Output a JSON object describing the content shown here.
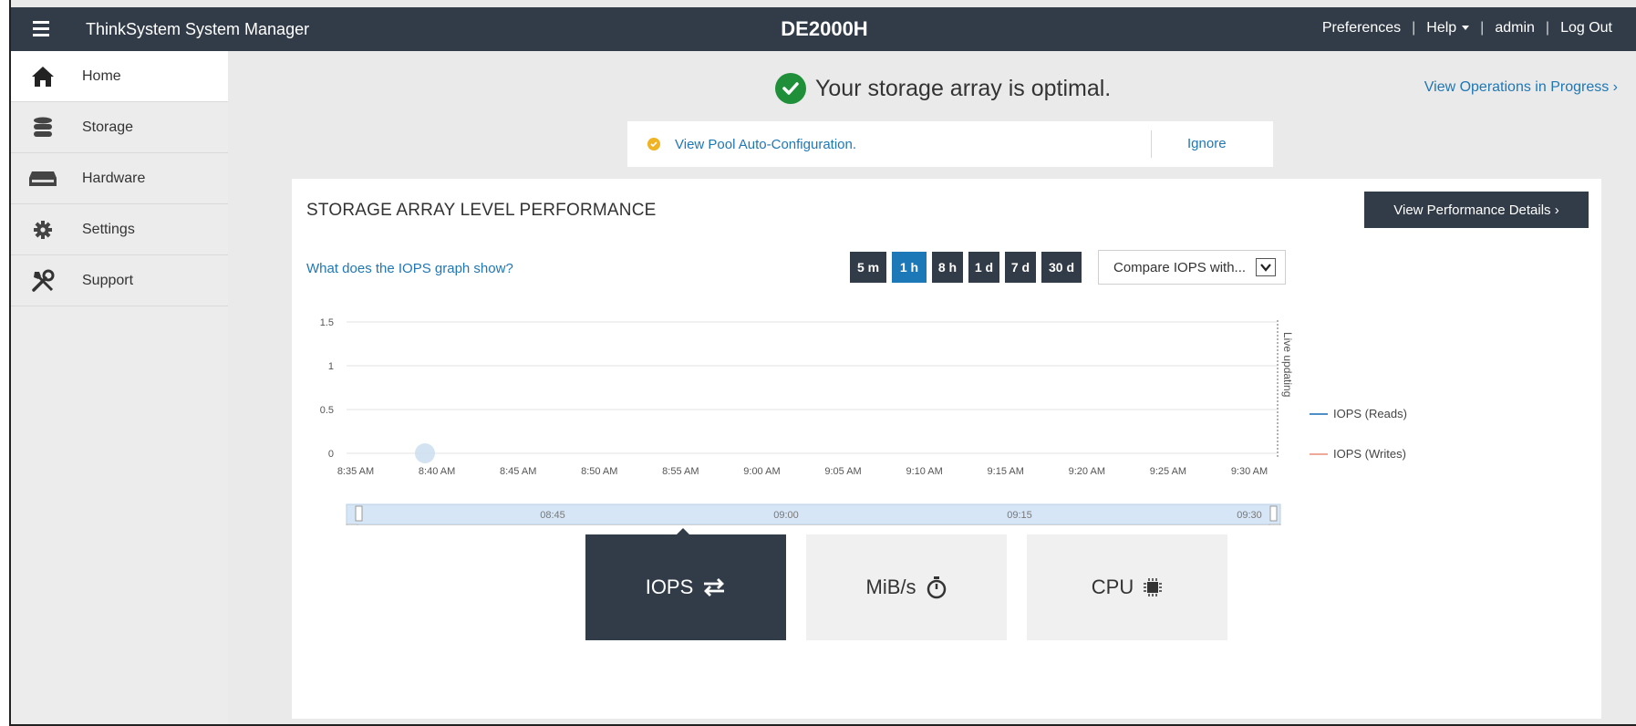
{
  "header": {
    "app_title": "ThinkSystem System Manager",
    "array_name": "DE2000H",
    "links": {
      "preferences": "Preferences",
      "help": "Help",
      "user": "admin",
      "logout": "Log Out"
    }
  },
  "sidebar": {
    "items": [
      {
        "label": "Home",
        "icon": "home-icon",
        "active": true
      },
      {
        "label": "Storage",
        "icon": "storage-icon",
        "active": false
      },
      {
        "label": "Hardware",
        "icon": "hardware-icon",
        "active": false
      },
      {
        "label": "Settings",
        "icon": "gear-icon",
        "active": false
      },
      {
        "label": "Support",
        "icon": "tools-icon",
        "active": false
      }
    ]
  },
  "main": {
    "status_text": "Your storage array is optimal.",
    "ops_link": "View Operations in Progress ›",
    "notice": {
      "link_text": "View Pool Auto-Configuration.",
      "ignore": "Ignore"
    },
    "panel": {
      "title": "STORAGE ARRAY LEVEL PERFORMANCE",
      "details_button": "View Performance Details ›",
      "help_link": "What does the IOPS graph show?",
      "ranges": [
        "5 m",
        "1 h",
        "8 h",
        "1 d",
        "7 d",
        "30 d"
      ],
      "active_range": "1 h",
      "compare_label": "Compare IOPS with...",
      "tabs": [
        {
          "label": "IOPS",
          "icon": "swap-arrows-icon",
          "active": true
        },
        {
          "label": "MiB/s",
          "icon": "stopwatch-icon",
          "active": false
        },
        {
          "label": "CPU",
          "icon": "cpu-chip-icon",
          "active": false
        }
      ]
    }
  },
  "colors": {
    "topbar": "#323c48",
    "accent": "#1d78b7",
    "ok": "#1f8f3a",
    "warn": "#f0b323"
  },
  "chart_data": {
    "type": "line",
    "ylim": [
      0,
      1.5
    ],
    "y_ticks": [
      "1.5",
      "1",
      "0.5",
      "0"
    ],
    "x_ticks": [
      "8:35 AM",
      "8:40 AM",
      "8:45 AM",
      "8:50 AM",
      "8:55 AM",
      "9:00 AM",
      "9:05 AM",
      "9:10 AM",
      "9:15 AM",
      "9:20 AM",
      "9:25 AM",
      "9:30 AM"
    ],
    "series": [
      {
        "name": "IOPS (Reads)",
        "color": "#4f8fc9",
        "values": []
      },
      {
        "name": "IOPS (Writes)",
        "color": "#f0a89a",
        "values": []
      }
    ],
    "legend": "right",
    "live_label": "Live updating",
    "navigator_ticks": [
      "08:45",
      "09:00",
      "09:15",
      "09:30"
    ],
    "grid": true
  }
}
